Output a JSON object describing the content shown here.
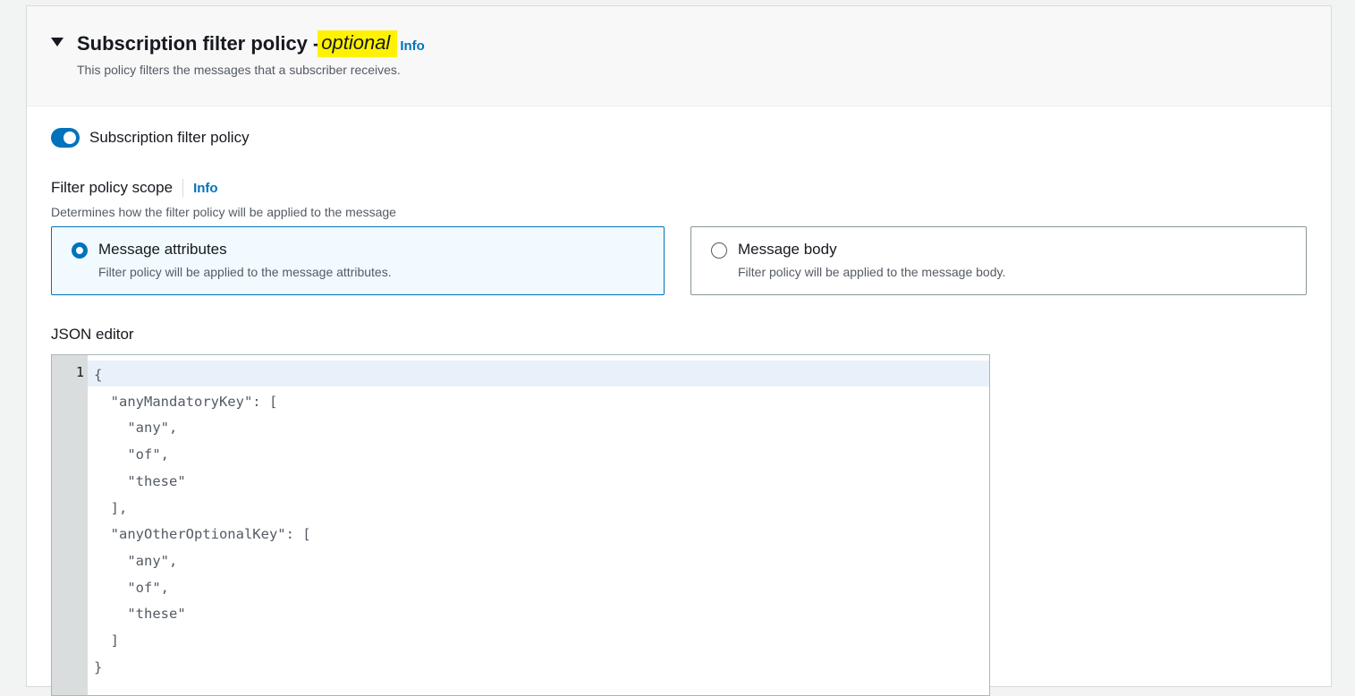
{
  "header": {
    "title": "Subscription filter policy",
    "dash": "-",
    "optional": "optional",
    "info": "Info",
    "description": "This policy filters the messages that a subscriber receives."
  },
  "toggle": {
    "label": "Subscription filter policy",
    "enabled": true
  },
  "scope": {
    "label": "Filter policy scope",
    "info": "Info",
    "description": "Determines how the filter policy will be applied to the message",
    "options": [
      {
        "title": "Message attributes",
        "description": "Filter policy will be applied to the message attributes.",
        "selected": true
      },
      {
        "title": "Message body",
        "description": "Filter policy will be applied to the message body.",
        "selected": false
      }
    ]
  },
  "json_editor": {
    "label": "JSON editor",
    "line_number": "1",
    "code": "{\n  \"anyMandatoryKey\": [\n    \"any\",\n    \"of\",\n    \"these\"\n  ],\n  \"anyOtherOptionalKey\": [\n    \"any\",\n    \"of\",\n    \"these\"\n  ]\n}"
  },
  "colors": {
    "accent": "#0073bb",
    "highlight": "#fff200",
    "selected_card_bg": "#f1faff"
  }
}
